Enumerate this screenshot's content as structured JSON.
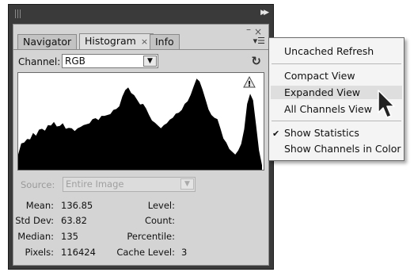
{
  "panel": {
    "tabs": [
      {
        "label": "Navigator"
      },
      {
        "label": "Histogram",
        "close": "×"
      },
      {
        "label": "Info"
      }
    ],
    "channel": {
      "label": "Channel:",
      "value": "RGB"
    },
    "source": {
      "label": "Source:",
      "value": "Entire Image"
    },
    "stats": {
      "mean": {
        "label": "Mean:",
        "value": "136.85"
      },
      "std_dev": {
        "label": "Std Dev:",
        "value": "63.82"
      },
      "median": {
        "label": "Median:",
        "value": "135"
      },
      "pixels": {
        "label": "Pixels:",
        "value": "116424"
      },
      "level": {
        "label": "Level:",
        "value": ""
      },
      "count": {
        "label": "Count:",
        "value": ""
      },
      "percentile": {
        "label": "Percentile:",
        "value": ""
      },
      "cache_level": {
        "label": "Cache Level:",
        "value": "3"
      }
    }
  },
  "histogram_levels": [
    0.15,
    0.28,
    0.3,
    0.35,
    0.32,
    0.4,
    0.38,
    0.42,
    0.44,
    0.43,
    0.5,
    0.47,
    0.52,
    0.48,
    0.46,
    0.5,
    0.45,
    0.47,
    0.44,
    0.42,
    0.46,
    0.45,
    0.48,
    0.5,
    0.52,
    0.54,
    0.56,
    0.55,
    0.57,
    0.58,
    0.6,
    0.62,
    0.64,
    0.66,
    0.7,
    0.78,
    0.86,
    0.9,
    0.85,
    0.8,
    0.76,
    0.72,
    0.7,
    0.66,
    0.6,
    0.55,
    0.5,
    0.48,
    0.46,
    0.47,
    0.5,
    0.55,
    0.58,
    0.6,
    0.62,
    0.66,
    0.7,
    0.74,
    0.82,
    0.92,
    0.98,
    0.96,
    0.88,
    0.75,
    0.65,
    0.6,
    0.58,
    0.54,
    0.45,
    0.35,
    0.28,
    0.22,
    0.2,
    0.18,
    0.2,
    0.28,
    0.45,
    0.7,
    0.82,
    0.76,
    0.5,
    0.2,
    0.05
  ],
  "menu": {
    "items": [
      {
        "label": "Uncached Refresh"
      },
      {
        "label": "Compact View"
      },
      {
        "label": "Expanded View",
        "checked": true
      },
      {
        "label": "All Channels View"
      },
      {
        "label": "Show Statistics",
        "checked": true
      },
      {
        "label": "Show Channels in Color"
      }
    ]
  },
  "colors": {
    "panel_bg": "#d4d4d4",
    "frame": "#3a3a3a",
    "histogram_fill": "#000000",
    "menu_highlight": "#dedede"
  }
}
